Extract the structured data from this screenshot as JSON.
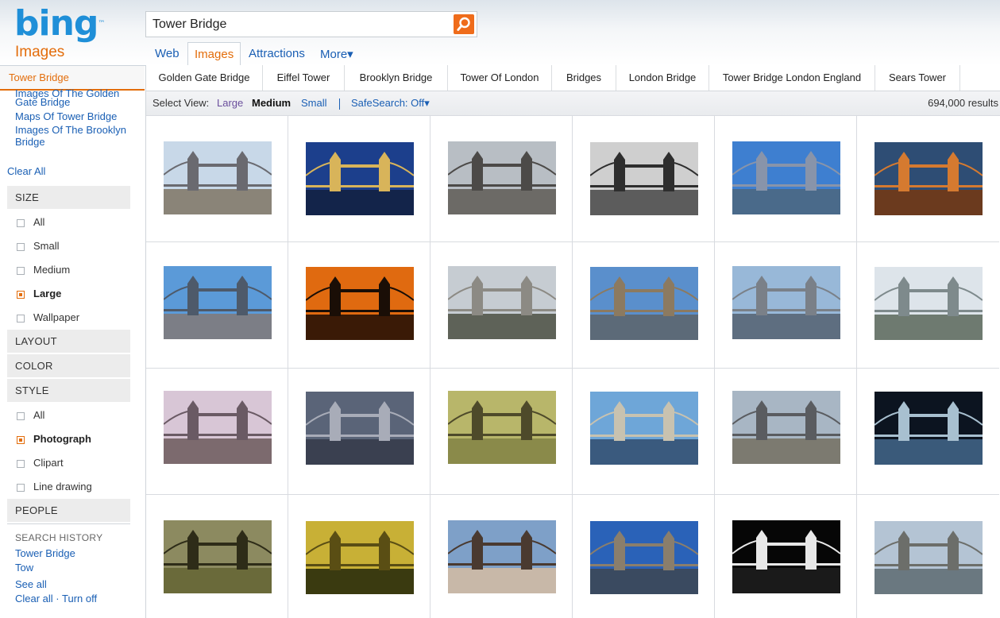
{
  "logo": {
    "text": "bing",
    "tm": "™",
    "vertical": "Images"
  },
  "search": {
    "query": "Tower Bridge"
  },
  "scopes": [
    "Web",
    "Images",
    "Attractions",
    "More▾"
  ],
  "related": [
    "Golden Gate Bridge",
    "Eiffel Tower",
    "Brooklyn Bridge",
    "Tower Of London",
    "Bridges",
    "London Bridge",
    "Tower Bridge London England",
    "Sears Tower"
  ],
  "viewbar": {
    "label": "Select View:",
    "large": "Large",
    "medium": "Medium",
    "small": "Small",
    "safesearch": "SafeSearch: Off▾",
    "results": "694,000 results"
  },
  "sidebar": {
    "current": "Tower Bridge",
    "related_cut": "Images Of The Golden",
    "related_links": [
      "Gate Bridge",
      "Maps Of Tower Bridge",
      "Images Of The Brooklyn",
      "Bridge"
    ],
    "clear_all": "Clear All",
    "size_head": "SIZE",
    "size_opts": [
      {
        "label": "All",
        "checked": false
      },
      {
        "label": "Small",
        "checked": false
      },
      {
        "label": "Medium",
        "checked": false
      },
      {
        "label": "Large",
        "checked": true
      },
      {
        "label": "Wallpaper",
        "checked": false
      }
    ],
    "layout_head": "LAYOUT",
    "color_head": "COLOR",
    "style_head": "STYLE",
    "style_opts": [
      {
        "label": "All",
        "checked": false
      },
      {
        "label": "Photograph",
        "checked": true
      },
      {
        "label": "Clipart",
        "checked": false
      },
      {
        "label": "Line drawing",
        "checked": false
      }
    ],
    "people_head": "PEOPLE",
    "history_title": "SEARCH HISTORY",
    "history_links": [
      "Tower Bridge",
      "Tow"
    ],
    "see_all": "See all",
    "clear_turn": "Clear all · Turn off"
  },
  "thumbs": [
    {
      "theme": "day-raised",
      "sky": "#c8d8e8",
      "water": "#8a8478",
      "tone": "#6a6a70"
    },
    {
      "theme": "night-blue",
      "sky": "#1c3f8c",
      "water": "#13244a",
      "tone": "#d8b45a"
    },
    {
      "theme": "overcast",
      "sky": "#b8bec4",
      "water": "#6c6a66",
      "tone": "#4c4a48"
    },
    {
      "theme": "bw-historic",
      "sky": "#cfcfcf",
      "water": "#5c5c5c",
      "tone": "#2e2e2e"
    },
    {
      "theme": "bright-blue",
      "sky": "#3e7fd0",
      "water": "#4a6a8a",
      "tone": "#8894aa"
    },
    {
      "theme": "sunset-angle",
      "sky": "#2e4d74",
      "water": "#6b3a1e",
      "tone": "#d57a30"
    },
    {
      "theme": "cloud-blue",
      "sky": "#5b9ad8",
      "water": "#7c7e86",
      "tone": "#4e5a6a"
    },
    {
      "theme": "sunset-orange",
      "sky": "#e06a10",
      "water": "#3a1a06",
      "tone": "#1a0e06"
    },
    {
      "theme": "raised-grey",
      "sky": "#c6ccd2",
      "water": "#5e6258",
      "tone": "#8c8a84"
    },
    {
      "theme": "clear-blue",
      "sky": "#5a8fcc",
      "water": "#5c6a78",
      "tone": "#8c7a60"
    },
    {
      "theme": "torn-paper",
      "sky": "#98b8d8",
      "water": "#5e6e80",
      "tone": "#7a8088"
    },
    {
      "theme": "pale-day",
      "sky": "#dde4ea",
      "water": "#6e7a70",
      "tone": "#7e8a8c"
    },
    {
      "theme": "pink-sky",
      "sky": "#d8c6d6",
      "water": "#7c6a6e",
      "tone": "#6a5a64"
    },
    {
      "theme": "storm-hdr",
      "sky": "#5a6478",
      "water": "#3a4050",
      "tone": "#a8acb8"
    },
    {
      "theme": "flood-green",
      "sky": "#b8b66a",
      "water": "#8a8a4a",
      "tone": "#4e4a2a"
    },
    {
      "theme": "light-blue",
      "sky": "#6ea6d8",
      "water": "#3a5a7e",
      "tone": "#c8c2b0"
    },
    {
      "theme": "haze",
      "sky": "#a8b6c4",
      "water": "#7c7a70",
      "tone": "#5a5c60"
    },
    {
      "theme": "dark-wave",
      "sky": "#0c1420",
      "water": "#3a5a7a",
      "tone": "#a8c0d0"
    },
    {
      "theme": "flood-brown",
      "sky": "#8c8a60",
      "water": "#6a6a3a",
      "tone": "#2e2c18"
    },
    {
      "theme": "golden-tree",
      "sky": "#c8b036",
      "water": "#3a3a10",
      "tone": "#5a4e14"
    },
    {
      "theme": "people",
      "sky": "#7ea0c8",
      "water": "#c8b8a8",
      "tone": "#4a3a30"
    },
    {
      "theme": "deep-blue",
      "sky": "#2a62b8",
      "water": "#3a4a60",
      "tone": "#8a7e6c"
    },
    {
      "theme": "night-bw",
      "sky": "#060606",
      "water": "#1a1a1a",
      "tone": "#e8e8e8"
    },
    {
      "theme": "grey-clear",
      "sky": "#b4c4d4",
      "water": "#6a7880",
      "tone": "#6c6e6a"
    }
  ]
}
